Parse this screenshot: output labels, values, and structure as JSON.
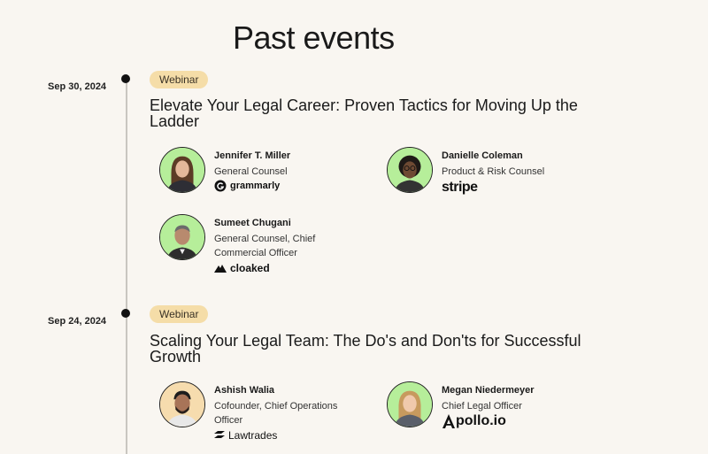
{
  "page": {
    "title": "Past events"
  },
  "colors": {
    "background": "#f9f6f1",
    "badge": "#f5dda8",
    "avatar_green": "#b6ee9a",
    "avatar_peach": "#f6dcae",
    "timeline": "#c9c6c0"
  },
  "events": [
    {
      "date": "Sep 30, 2024",
      "badge": "Webinar",
      "title": "Elevate Your Legal Career: Proven Tactics for Moving Up the Ladder",
      "speakers": [
        {
          "name": "Jennifer T. Miller",
          "role": "General Counsel",
          "company": "grammarly",
          "icon": "grammarly-logo-icon"
        },
        {
          "name": "Danielle Coleman",
          "role": "Product & Risk Counsel",
          "company": "stripe",
          "icon": ""
        },
        {
          "name": "Sumeet Chugani",
          "role": "General Counsel, Chief Commercial Officer",
          "company": "cloaked",
          "icon": "cloaked-logo-icon"
        }
      ]
    },
    {
      "date": "Sep 24, 2024",
      "badge": "Webinar",
      "title": "Scaling Your Legal Team: The Do's and Don'ts for Successful Growth",
      "speakers": [
        {
          "name": "Ashish Walia",
          "role": "Cofounder, Chief Operations Officer",
          "company": "Lawtrades",
          "icon": "lawtrades-logo-icon"
        },
        {
          "name": "Megan Niedermeyer",
          "role": "Chief Legal Officer",
          "company": "pollo.io",
          "icon": "apollo-a-logo-icon"
        }
      ]
    }
  ]
}
